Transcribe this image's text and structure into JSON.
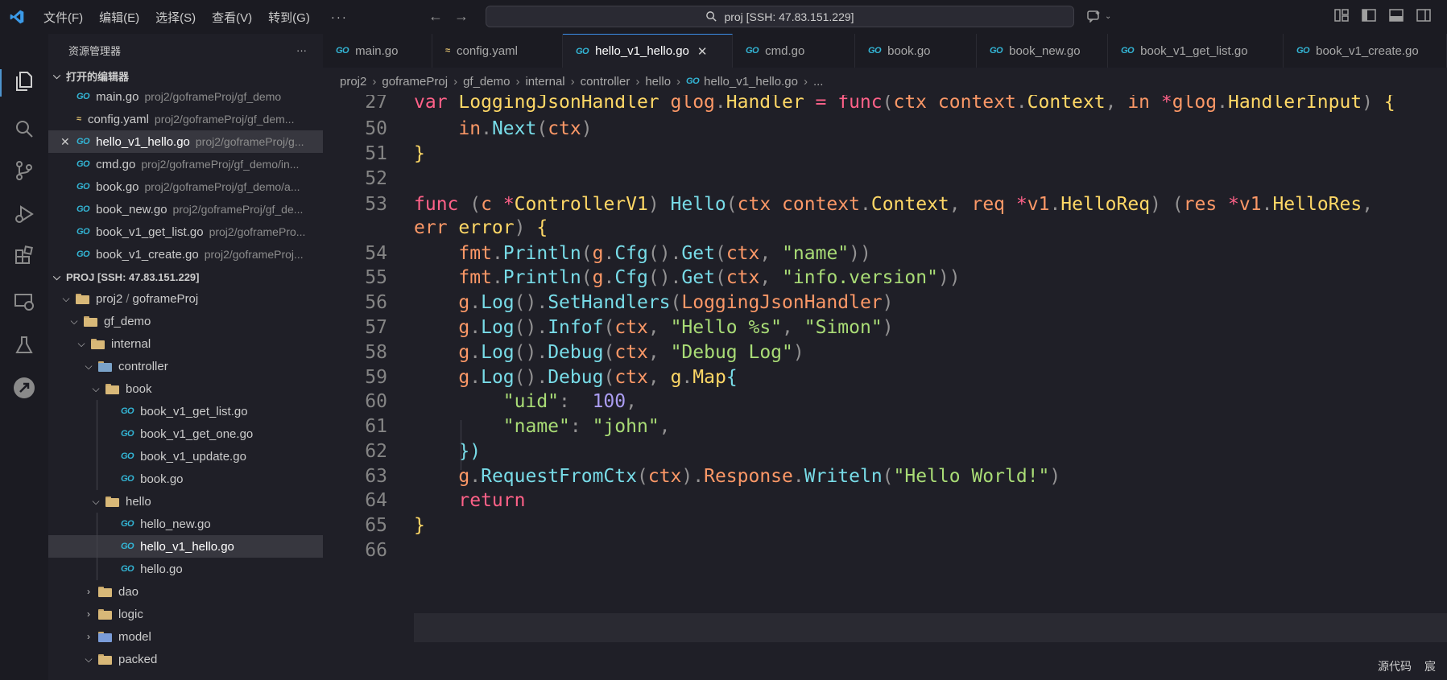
{
  "menu": [
    "文件(F)",
    "编辑(E)",
    "选择(S)",
    "查看(V)",
    "转到(G)",
    "···"
  ],
  "search": {
    "text": "proj [SSH: 47.83.151.229]"
  },
  "sidebar": {
    "title": "资源管理器",
    "more": "···",
    "open_editors_label": "打开的编辑器",
    "open_editors": [
      {
        "name": "main.go",
        "path": "proj2/goframeProj/gf_demo",
        "icon": "go"
      },
      {
        "name": "config.yaml",
        "path": "proj2/goframeProj/gf_dem...",
        "icon": "yaml"
      },
      {
        "name": "hello_v1_hello.go",
        "path": "proj2/goframeProj/g...",
        "icon": "go"
      },
      {
        "name": "cmd.go",
        "path": "proj2/goframeProj/gf_demo/in...",
        "icon": "go"
      },
      {
        "name": "book.go",
        "path": "proj2/goframeProj/gf_demo/a...",
        "icon": "go"
      },
      {
        "name": "book_new.go",
        "path": "proj2/goframeProj/gf_de...",
        "icon": "go"
      },
      {
        "name": "book_v1_get_list.go",
        "path": "proj2/goframePro...",
        "icon": "go"
      },
      {
        "name": "book_v1_create.go",
        "path": "proj2/goframeProj...",
        "icon": "go"
      }
    ],
    "project_label": "PROJ [SSH: 47.83.151.229]",
    "tree": {
      "proj2": "proj2",
      "slash": "/",
      "goframeProj": "goframeProj",
      "gf_demo": "gf_demo",
      "internal": "internal",
      "controller": "controller",
      "book": "book",
      "book_files": [
        "book_v1_get_list.go",
        "book_v1_get_one.go",
        "book_v1_update.go",
        "book.go"
      ],
      "hello": "hello",
      "hello_files": [
        "hello_new.go",
        "hello_v1_hello.go",
        "hello.go"
      ],
      "dao": "dao",
      "logic": "logic",
      "model": "model",
      "packed": "packed"
    }
  },
  "tabs": [
    "main.go",
    "config.yaml",
    "hello_v1_hello.go",
    "cmd.go",
    "book.go",
    "book_new.go",
    "book_v1_get_list.go",
    "book_v1_create.go"
  ],
  "active_tab": "hello_v1_hello.go",
  "breadcrumb": [
    "proj2",
    "goframeProj",
    "gf_demo",
    "internal",
    "controller",
    "hello",
    "hello_v1_hello.go",
    "..."
  ],
  "code": {
    "line_numbers": [
      "27",
      "50",
      "51",
      "52",
      "53",
      "",
      "54",
      "55",
      "56",
      "57",
      "58",
      "59",
      "60",
      "61",
      "62",
      "63",
      "64",
      "65",
      "66"
    ],
    "lines": [
      [
        [
          "kw",
          "var "
        ],
        [
          "ty",
          "LoggingJsonHandler "
        ],
        [
          "pk",
          "glog"
        ],
        [
          "pn",
          "."
        ],
        [
          "ty",
          "Handler "
        ],
        [
          "op",
          "= "
        ],
        [
          "kw",
          "func"
        ],
        [
          "pn",
          "("
        ],
        [
          "vr",
          "ctx "
        ],
        [
          "pk",
          "context"
        ],
        [
          "pn",
          "."
        ],
        [
          "ty",
          "Context"
        ],
        [
          "pn",
          ", "
        ],
        [
          "vr",
          "in "
        ],
        [
          "op",
          "*"
        ],
        [
          "pk",
          "glog"
        ],
        [
          "pn",
          "."
        ],
        [
          "ty",
          "HandlerInput"
        ],
        [
          "pn",
          ") "
        ],
        [
          "ty",
          "{"
        ]
      ],
      [
        [
          "pn",
          "    "
        ],
        [
          "vr",
          "in"
        ],
        [
          "pn",
          "."
        ],
        [
          "fn",
          "Next"
        ],
        [
          "pn",
          "("
        ],
        [
          "vr",
          "ctx"
        ],
        [
          "pn",
          ")"
        ]
      ],
      [
        [
          "ty",
          "}"
        ]
      ],
      [],
      [
        [
          "kw",
          "func "
        ],
        [
          "pn",
          "("
        ],
        [
          "vr",
          "c "
        ],
        [
          "op",
          "*"
        ],
        [
          "ty",
          "ControllerV1"
        ],
        [
          "pn",
          ") "
        ],
        [
          "fn",
          "Hello"
        ],
        [
          "pn",
          "("
        ],
        [
          "vr",
          "ctx "
        ],
        [
          "pk",
          "context"
        ],
        [
          "pn",
          "."
        ],
        [
          "ty",
          "Context"
        ],
        [
          "pn",
          ", "
        ],
        [
          "vr",
          "req "
        ],
        [
          "op",
          "*"
        ],
        [
          "pk",
          "v1"
        ],
        [
          "pn",
          "."
        ],
        [
          "ty",
          "HelloReq"
        ],
        [
          "pn",
          ") ("
        ],
        [
          "vr",
          "res "
        ],
        [
          "op",
          "*"
        ],
        [
          "pk",
          "v1"
        ],
        [
          "pn",
          "."
        ],
        [
          "ty",
          "HelloRes"
        ],
        [
          "pn",
          ","
        ]
      ],
      [
        [
          "vr",
          "err "
        ],
        [
          "ty",
          "error"
        ],
        [
          "pn",
          ") "
        ],
        [
          "ty",
          "{"
        ]
      ],
      [
        [
          "pn",
          "    "
        ],
        [
          "pk",
          "fmt"
        ],
        [
          "pn",
          "."
        ],
        [
          "fn",
          "Println"
        ],
        [
          "pn",
          "("
        ],
        [
          "pk",
          "g"
        ],
        [
          "pn",
          "."
        ],
        [
          "fn",
          "Cfg"
        ],
        [
          "pn",
          "()."
        ],
        [
          "fn",
          "Get"
        ],
        [
          "pn",
          "("
        ],
        [
          "vr",
          "ctx"
        ],
        [
          "pn",
          ", "
        ],
        [
          "st",
          "\"name\""
        ],
        [
          "pn",
          "))"
        ]
      ],
      [
        [
          "pn",
          "    "
        ],
        [
          "pk",
          "fmt"
        ],
        [
          "pn",
          "."
        ],
        [
          "fn",
          "Println"
        ],
        [
          "pn",
          "("
        ],
        [
          "pk",
          "g"
        ],
        [
          "pn",
          "."
        ],
        [
          "fn",
          "Cfg"
        ],
        [
          "pn",
          "()."
        ],
        [
          "fn",
          "Get"
        ],
        [
          "pn",
          "("
        ],
        [
          "vr",
          "ctx"
        ],
        [
          "pn",
          ", "
        ],
        [
          "st",
          "\"info.version\""
        ],
        [
          "pn",
          "))"
        ]
      ],
      [
        [
          "pn",
          "    "
        ],
        [
          "pk",
          "g"
        ],
        [
          "pn",
          "."
        ],
        [
          "fn",
          "Log"
        ],
        [
          "pn",
          "()."
        ],
        [
          "fn",
          "SetHandlers"
        ],
        [
          "pn",
          "("
        ],
        [
          "vr",
          "LoggingJsonHandler"
        ],
        [
          "pn",
          ")"
        ]
      ],
      [
        [
          "pn",
          "    "
        ],
        [
          "pk",
          "g"
        ],
        [
          "pn",
          "."
        ],
        [
          "fn",
          "Log"
        ],
        [
          "pn",
          "()."
        ],
        [
          "fn",
          "Infof"
        ],
        [
          "pn",
          "("
        ],
        [
          "vr",
          "ctx"
        ],
        [
          "pn",
          ", "
        ],
        [
          "st",
          "\"Hello %s\""
        ],
        [
          "pn",
          ", "
        ],
        [
          "st",
          "\"Simon\""
        ],
        [
          "pn",
          ")"
        ]
      ],
      [
        [
          "pn",
          "    "
        ],
        [
          "pk",
          "g"
        ],
        [
          "pn",
          "."
        ],
        [
          "fn",
          "Log"
        ],
        [
          "pn",
          "()."
        ],
        [
          "fn",
          "Debug"
        ],
        [
          "pn",
          "("
        ],
        [
          "vr",
          "ctx"
        ],
        [
          "pn",
          ", "
        ],
        [
          "st",
          "\"Debug Log\""
        ],
        [
          "pn",
          ")"
        ]
      ],
      [
        [
          "pn",
          "    "
        ],
        [
          "pk",
          "g"
        ],
        [
          "pn",
          "."
        ],
        [
          "fn",
          "Log"
        ],
        [
          "pn",
          "()."
        ],
        [
          "fn",
          "Debug"
        ],
        [
          "pn",
          "("
        ],
        [
          "vr",
          "ctx"
        ],
        [
          "pn",
          ", "
        ],
        [
          "ty",
          "g"
        ],
        [
          "pn",
          "."
        ],
        [
          "ty",
          "Map"
        ],
        [
          "fn",
          "{"
        ]
      ],
      [
        [
          "pn",
          "        "
        ],
        [
          "st",
          "\"uid\""
        ],
        [
          "pn",
          ":  "
        ],
        [
          "nm",
          "100"
        ],
        [
          "pn",
          ","
        ]
      ],
      [
        [
          "pn",
          "        "
        ],
        [
          "st",
          "\"name\""
        ],
        [
          "pn",
          ": "
        ],
        [
          "st",
          "\"john\""
        ],
        [
          "pn",
          ","
        ]
      ],
      [
        [
          "pn",
          "    "
        ],
        [
          "fn",
          "})"
        ]
      ],
      [
        [
          "pn",
          "    "
        ],
        [
          "pk",
          "g"
        ],
        [
          "pn",
          "."
        ],
        [
          "fn",
          "RequestFromCtx"
        ],
        [
          "pn",
          "("
        ],
        [
          "vr",
          "ctx"
        ],
        [
          "pn",
          ")."
        ],
        [
          "vr",
          "Response"
        ],
        [
          "pn",
          "."
        ],
        [
          "fn",
          "Writeln"
        ],
        [
          "pn",
          "("
        ],
        [
          "st",
          "\"Hello World!\""
        ],
        [
          "pn",
          ")"
        ]
      ],
      [
        [
          "pn",
          "    "
        ],
        [
          "kw",
          "return"
        ]
      ],
      [
        [
          "ty",
          "}"
        ]
      ],
      []
    ]
  },
  "status": {
    "language": "源代码",
    "user": "宸"
  }
}
